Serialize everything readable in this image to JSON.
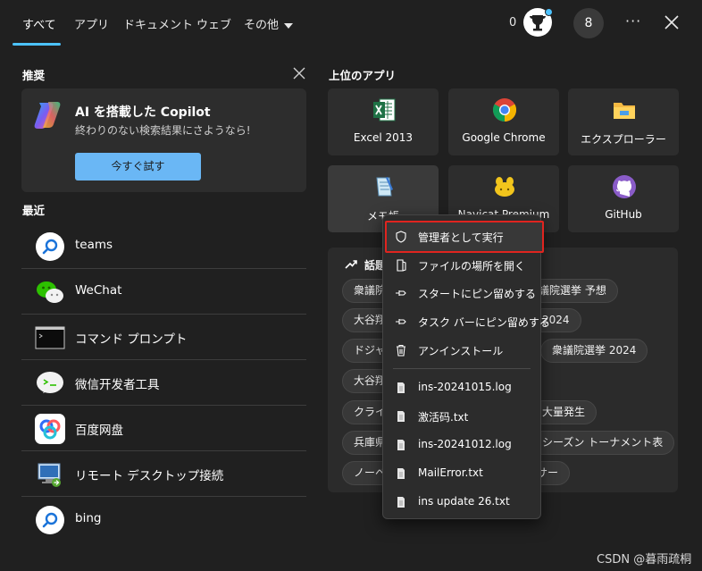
{
  "topbar": {
    "tabs": [
      "すべて",
      "アプリ",
      "ドキュメント",
      "ウェブ",
      "その他"
    ],
    "points": "0",
    "avatar_letter": "8",
    "more": "···"
  },
  "recommended": {
    "title": "推奨",
    "copilot_title": "AI を搭載した Copilot",
    "copilot_sub": "終わりのない検索結果にさようなら!",
    "copilot_button": "今すぐ試す"
  },
  "recent": {
    "title": "最近",
    "items": [
      {
        "label": "teams",
        "icon": "search-icon"
      },
      {
        "label": "WeChat",
        "icon": "wechat-icon"
      },
      {
        "label": "コマンド プロンプト",
        "icon": "terminal-icon"
      },
      {
        "label": "微信开发者工具",
        "icon": "dev-tools-icon"
      },
      {
        "label": "百度网盘",
        "icon": "baidu-netdisk-icon"
      },
      {
        "label": "リモート デスクトップ接続",
        "icon": "remote-desktop-icon"
      },
      {
        "label": "bing",
        "icon": "search-icon"
      }
    ]
  },
  "top_apps": {
    "title": "上位のアプリ",
    "apps": [
      {
        "label": "Excel 2013",
        "icon": "excel-icon"
      },
      {
        "label": "Google Chrome",
        "icon": "chrome-icon"
      },
      {
        "label": "エクスプローラー",
        "icon": "folder-icon"
      },
      {
        "label": "メモ帳",
        "icon": "notepad-icon"
      },
      {
        "label": "Navicat Premium",
        "icon": "navicat-icon"
      },
      {
        "label": "GitHub",
        "icon": "github-icon"
      }
    ]
  },
  "trending": {
    "title": "話題",
    "chips": [
      "衆議院",
      "議院選挙 予想",
      "大谷翔",
      "2024",
      "ドジャー",
      "衆議院選挙 2024",
      "大谷翔",
      "クライマ",
      "大量発生",
      "兵庫県",
      "シーズン トーナメント表",
      "ノーベル",
      "サー"
    ]
  },
  "context_menu": {
    "items": [
      {
        "label": "管理者として実行",
        "icon": "shield-icon"
      },
      {
        "label": "ファイルの場所を開く",
        "icon": "open-folder-icon"
      },
      {
        "label": "スタートにピン留めする",
        "icon": "pin-icon"
      },
      {
        "label": "タスク バーにピン留めする",
        "icon": "pin-icon"
      },
      {
        "label": "アンインストール",
        "icon": "trash-icon"
      }
    ],
    "files": [
      {
        "label": "ins-20241015.log",
        "icon": "file-icon"
      },
      {
        "label": "激活码.txt",
        "icon": "file-icon"
      },
      {
        "label": "ins-20241012.log",
        "icon": "file-icon"
      },
      {
        "label": "MailError.txt",
        "icon": "file-icon"
      },
      {
        "label": "ins update 26.txt",
        "icon": "file-icon"
      }
    ]
  },
  "watermark": "CSDN @暮雨疏桐",
  "colors": {
    "background": "#202020",
    "accent": "#4cc2ff",
    "button": "#6ab7f5",
    "highlight_border": "#e0241f"
  }
}
